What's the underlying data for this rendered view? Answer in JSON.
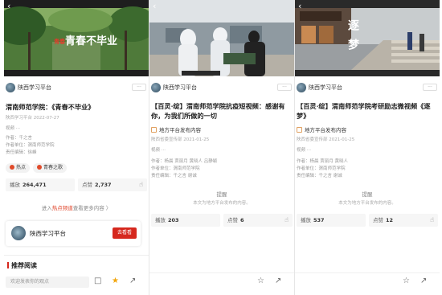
{
  "panels": [
    {
      "video_caption": "青春不毕业",
      "account": "陕西学习平台",
      "follow": "···",
      "title": "渭南师范学院：《青春不毕业》",
      "date": "陕西学习平台 2022-07-27",
      "label_a": "视频 ···",
      "lines": [
        "作者：千之言",
        "作者单位：渭南师范学院",
        "责任编辑：徐峰"
      ],
      "tags": [
        "热点",
        "青春之歌"
      ],
      "views_label": "播放",
      "views": "264,471",
      "likes_label": "点赞",
      "likes": "2,737",
      "hot_prefix": "进入",
      "hot_link": "热点频道",
      "hot_suffix": "查看更多内容 〉",
      "card_name": "陕西学习平台",
      "card_button": "去看看",
      "rec_title": "推荐阅读",
      "comment_placeholder": "欢迎发表你的观点"
    },
    {
      "account": "陕西学习平台",
      "follow": "···",
      "title": "【百灵·绽】渭南师范学院抗疫短视频：感谢有你，为我们所做的一切",
      "publisher": "地方平台发布内容",
      "date": "陕西省委宣传部 2021-01-25",
      "label_a": "视频 ···",
      "lines": [
        "作者：杨晨 贾丽月 黄晓人 吕静颖",
        "作者单位：渭南师范学院",
        "责任编辑：千之言 谢诚"
      ],
      "notice_head": "提醒",
      "notice_sub": "本文为地方平台发布的内容。",
      "views_label": "播放",
      "views": "203",
      "likes_label": "点赞",
      "likes": "6"
    },
    {
      "account": "陕西学习平台",
      "follow": "···",
      "video_caption": "逐梦",
      "title": "【百灵·绽】渭南师范学院考研励志微视频《逐梦》",
      "publisher": "地方平台发布内容",
      "date": "陕西省委宣传部 2021-01-25",
      "label_a": "视频 ···",
      "lines": [
        "作者：杨晨 贾丽月 黄晓人",
        "作者单位：渭南师范学院",
        "责任编辑：千之言 谢诚"
      ],
      "notice_head": "提醒",
      "notice_sub": "本文为地方平台发布的内容。",
      "views_label": "播放",
      "views": "537",
      "likes_label": "点赞",
      "likes": "12"
    }
  ],
  "icons": {
    "back": "back-chevron-icon",
    "thumb": "thumb-up-icon",
    "comment": "comment-icon",
    "star": "star-icon",
    "share": "share-icon"
  },
  "colors": {
    "accent_red": "#d6281e",
    "star_active": "#f2a60e"
  }
}
